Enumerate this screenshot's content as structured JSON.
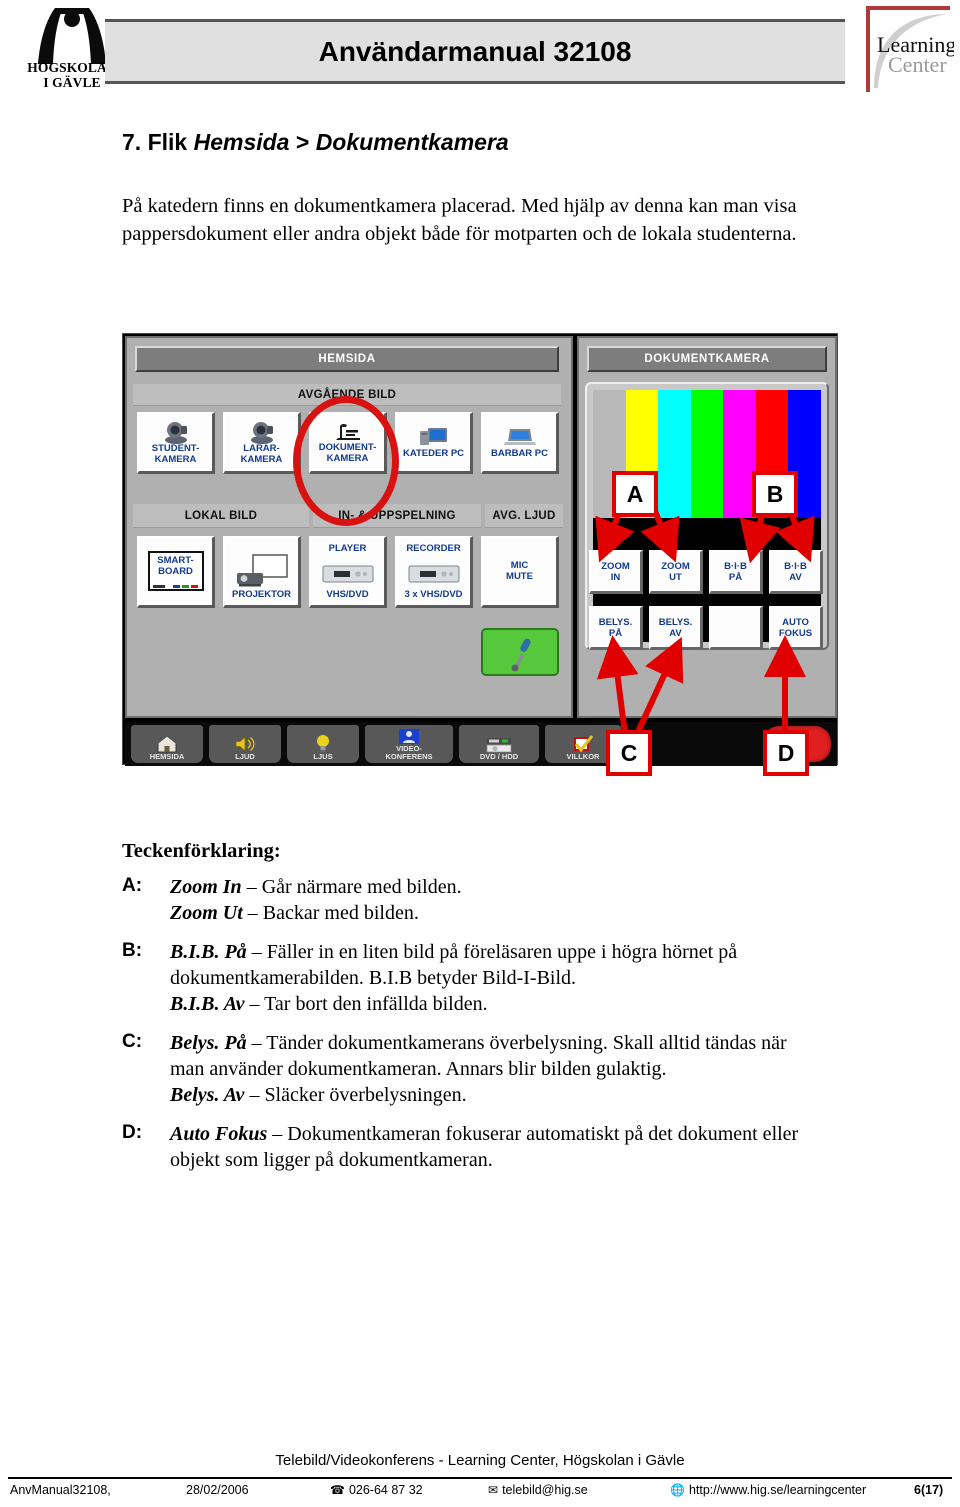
{
  "header": {
    "title": "Användarmanual 32108",
    "left_logo": {
      "name": "hogskolan-i-gavle-logo",
      "line1": "HÖGSKOLAN",
      "line2": "I GÄVLE"
    },
    "right_logo": {
      "name": "learning-center-logo",
      "line1": "Learning",
      "line2": "Center",
      "accent_color": "#b03a3a"
    }
  },
  "section": {
    "number": "7.",
    "word": "Flik",
    "tab": "Hemsida",
    "separator": ">",
    "page": "Dokumentkamera",
    "intro": "På katedern finns en dokumentkamera placerad. Med hjälp av denna kan man visa pappersdokument eller andra objekt både för motparten och de lokala studenterna."
  },
  "panel": {
    "left_tab_title": "HEMSIDA",
    "right_tab_title": "DOKUMENTKAMERA",
    "groups": {
      "outgoing": "AVGÅENDE BILD",
      "local": "LOKAL BILD",
      "playback": "IN- & UPPSPELNING",
      "audio": "AVG. LJUD"
    },
    "outgoing_buttons": [
      {
        "icon": "ptz-camera-icon",
        "l1": "STUDENT-",
        "l2": "KAMERA"
      },
      {
        "icon": "ptz-camera-icon",
        "l1": "LARAR-",
        "l2": "KAMERA"
      },
      {
        "icon": "document-camera-icon",
        "l1": "DOKUMENT-",
        "l2": "KAMERA"
      },
      {
        "icon": "desktop-pc-icon",
        "l1": "KATEDER PC",
        "l2": ""
      },
      {
        "icon": "laptop-icon",
        "l1": "BARBAR PC",
        "l2": ""
      }
    ],
    "local_buttons": [
      {
        "icon": "whiteboard-icon",
        "top1": "SMART-",
        "top2": "BOARD",
        "bottom": ""
      },
      {
        "icon": "projector-icon",
        "top1": "",
        "top2": "",
        "bottom": "PROJEKTOR"
      },
      {
        "icon": "vcr-icon",
        "top1": "PLAYER",
        "top2": "",
        "bottom": "VHS/DVD"
      },
      {
        "icon": "vcr-icon",
        "top1": "RECORDER",
        "top2": "",
        "bottom": "3 x VHS/DVD"
      },
      {
        "icon": "mic-mute-icon",
        "top1": "MIC",
        "top2": "MUTE",
        "bottom": ""
      }
    ],
    "mic_toggle": {
      "name": "microphone-toggle",
      "color": "#55c83c"
    },
    "doccam_buttons": [
      {
        "l1": "ZOOM",
        "l2": "IN"
      },
      {
        "l1": "ZOOM",
        "l2": "UT"
      },
      {
        "l1": "B·I·B",
        "l2": "PÅ"
      },
      {
        "l1": "B·I·B",
        "l2": "AV"
      },
      {
        "l1": "BELYS.",
        "l2": "PÅ"
      },
      {
        "l1": "BELYS.",
        "l2": "AV"
      },
      {
        "l1": "",
        "l2": ""
      },
      {
        "l1": "AUTO",
        "l2": "FOKUS"
      }
    ],
    "preview_colorbars": [
      "#b9b9b9",
      "#ffff00",
      "#00ffff",
      "#00ff00",
      "#ff00ff",
      "#ff0000",
      "#0000ff"
    ],
    "taskbar": [
      {
        "icon": "house-icon",
        "l1": "HEMSIDA",
        "l2": ""
      },
      {
        "icon": "speaker-icon",
        "l1": "LJUD",
        "l2": ""
      },
      {
        "icon": "lightbulb-icon",
        "l1": "LJUS",
        "l2": ""
      },
      {
        "icon": "videoconference-icon",
        "l1": "VIDEO-",
        "l2": "KONFERENS"
      },
      {
        "icon": "disc-icon",
        "l1": "DVD / HDD",
        "l2": ""
      },
      {
        "icon": "checkmark-icon",
        "l1": "VILLKOR",
        "l2": ""
      }
    ],
    "power_button": {
      "name": "power-button",
      "color": "#e02020"
    },
    "callouts": [
      {
        "label": "A"
      },
      {
        "label": "B"
      },
      {
        "label": "C"
      },
      {
        "label": "D"
      }
    ],
    "highlight": {
      "name": "dokumentkamera-highlight-ellipse",
      "color": "#d81111"
    }
  },
  "legend": {
    "title": "Teckenförklaring:",
    "rows": [
      {
        "key": "A:",
        "lines": [
          {
            "bold": "Zoom In",
            "rest": " – Går närmare med bilden."
          },
          {
            "bold": "Zoom Ut",
            "rest": " – Backar med bilden."
          }
        ]
      },
      {
        "key": "B:",
        "lines": [
          {
            "bold": "B.I.B. På",
            "rest": " – Fäller in en liten bild på föreläsaren  uppe i högra hörnet på dokumentkamerabilden. B.I.B betyder Bild-I-Bild."
          },
          {
            "bold": "B.I.B. Av",
            "rest": " – Tar bort den infällda bilden."
          }
        ]
      },
      {
        "key": "C:",
        "lines": [
          {
            "bold": "Belys. På",
            "rest": " – Tänder dokumentkamerans överbelysning. Skall alltid tändas när man använder dokumentkameran. Annars blir bilden gulaktig."
          },
          {
            "bold": "Belys. Av",
            "rest": " – Släcker överbelysningen."
          }
        ]
      },
      {
        "key": "D:",
        "lines": [
          {
            "bold": "Auto Fokus",
            "rest": " – Dokumentkameran fokuserar automatiskt på det dokument eller objekt som ligger på dokumentkameran."
          }
        ]
      }
    ]
  },
  "footer": {
    "org": "Telebild/Videokonferens - Learning Center, Högskolan i Gävle",
    "doc_id": "AnvManual32108,",
    "date": "28/02/2006",
    "phone_icon": "phone-icon",
    "phone": "026-64 87 32",
    "mail_icon": "envelope-icon",
    "email": "telebild@hig.se",
    "web_icon": "globe-icon",
    "url": "http://www.hig.se/learningcenter",
    "page": "6(17)"
  }
}
